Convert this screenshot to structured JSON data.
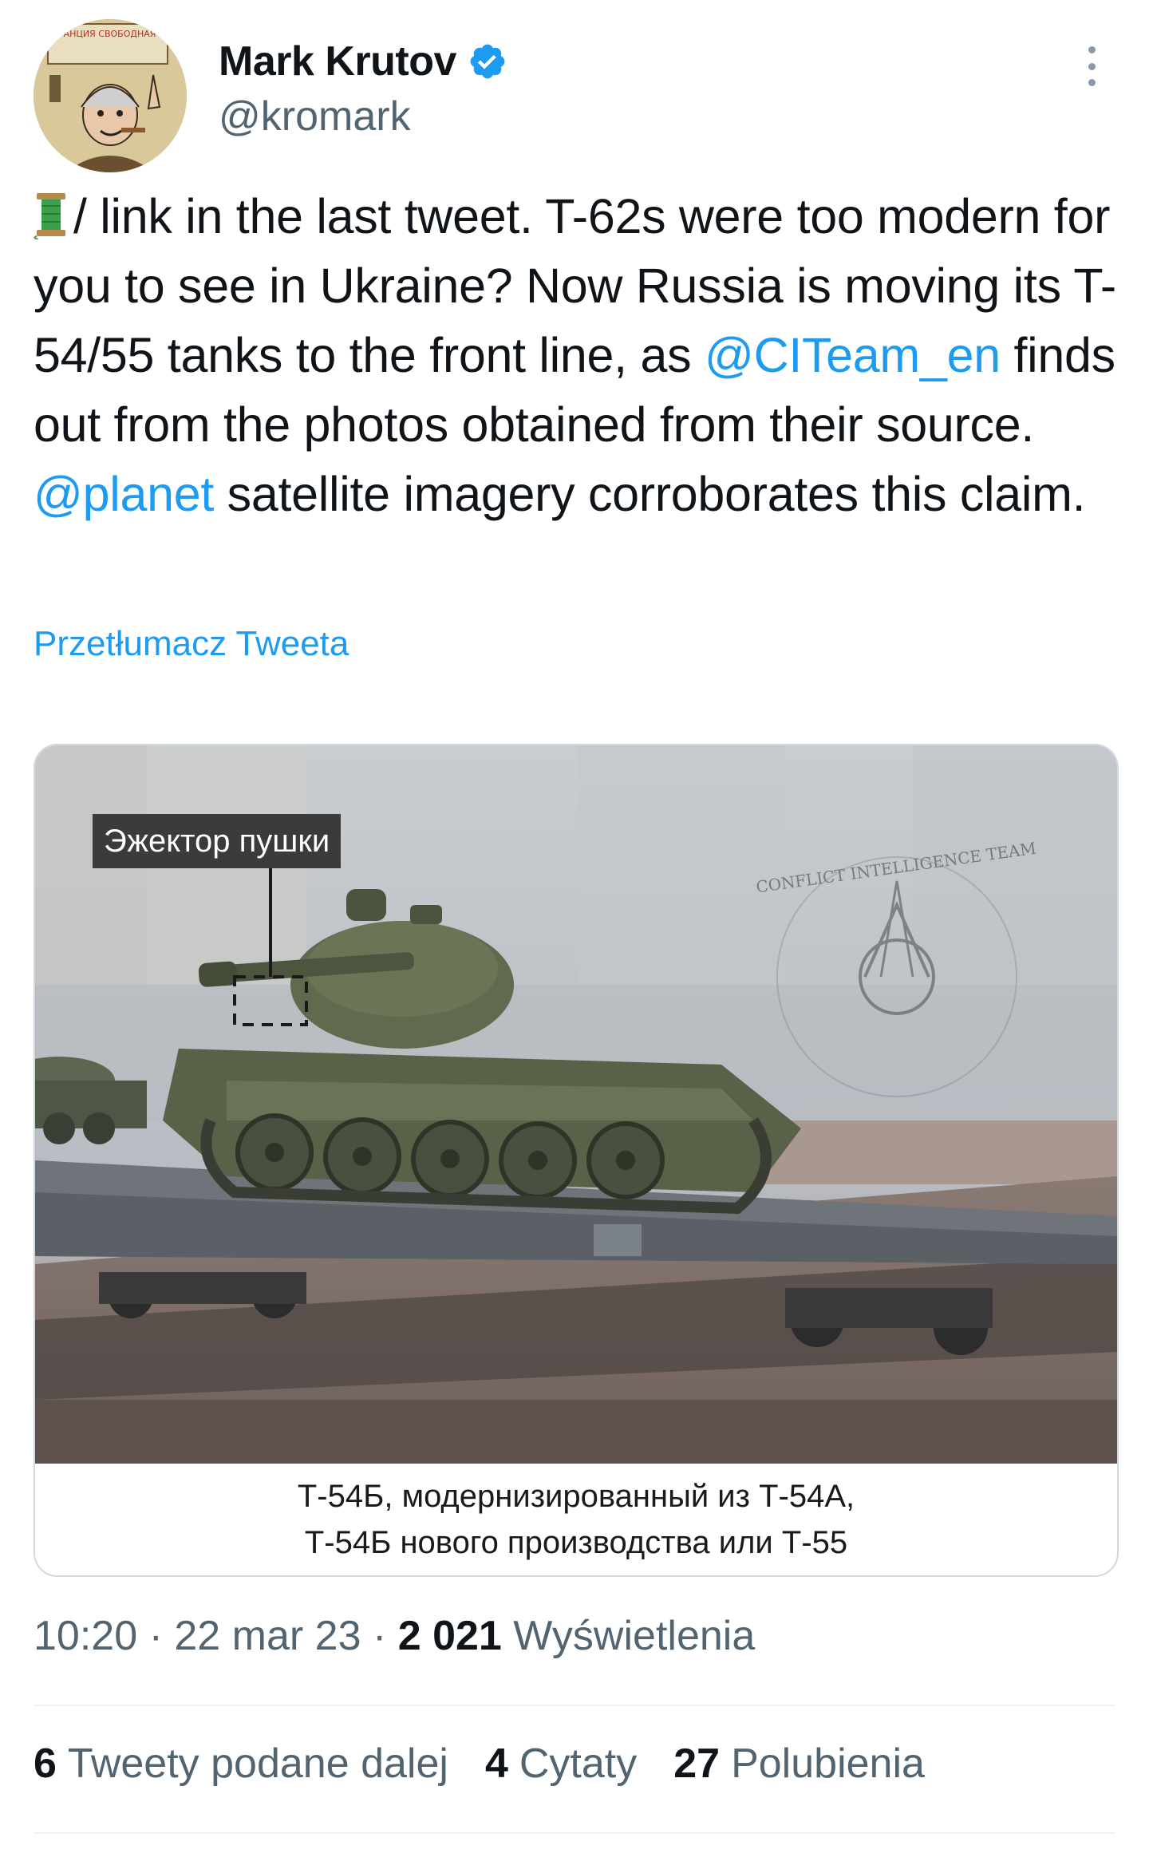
{
  "author": {
    "display_name": "Mark Krutov",
    "handle": "@kromark",
    "verified": true,
    "avatar_text": "РАДИОСТАНЦИЯ СВОБОДНАЯ ЕВРОПА"
  },
  "tweet": {
    "text_parts": [
      "/ link in the last tweet. T-62s were too modern for you to see in Ukraine? Now Russia is moving its T-54/55 tanks to the front line, as ",
      "@CITeam_en",
      " finds out from the photos obtained from their source. ",
      "@planet",
      " satellite imagery corroborates this claim."
    ],
    "translate_label": "Przetłumacz Tweeta"
  },
  "media": {
    "overlay_label": "Эжектор пушки",
    "watermark": "CONFLICT INTELLIGENCE TEAM",
    "caption_line1": "Т-54Б, модернизированный из Т-54А,",
    "caption_line2": "Т-54Б нового производства или Т-55"
  },
  "meta": {
    "time": "10:20",
    "sep1": " · ",
    "date": "22 mar 23",
    "sep2": " · ",
    "views_count": "2 021",
    "views_label": " Wyświetlenia"
  },
  "stats": {
    "retweets_count": "6",
    "retweets_label": "Tweety podane dalej",
    "quotes_count": "4",
    "quotes_label": "Cytaty",
    "likes_count": "27",
    "likes_label": "Polubienia"
  },
  "colors": {
    "accent": "#1d9bf0",
    "secondary_text": "#536471",
    "primary_text": "#0f1419"
  }
}
